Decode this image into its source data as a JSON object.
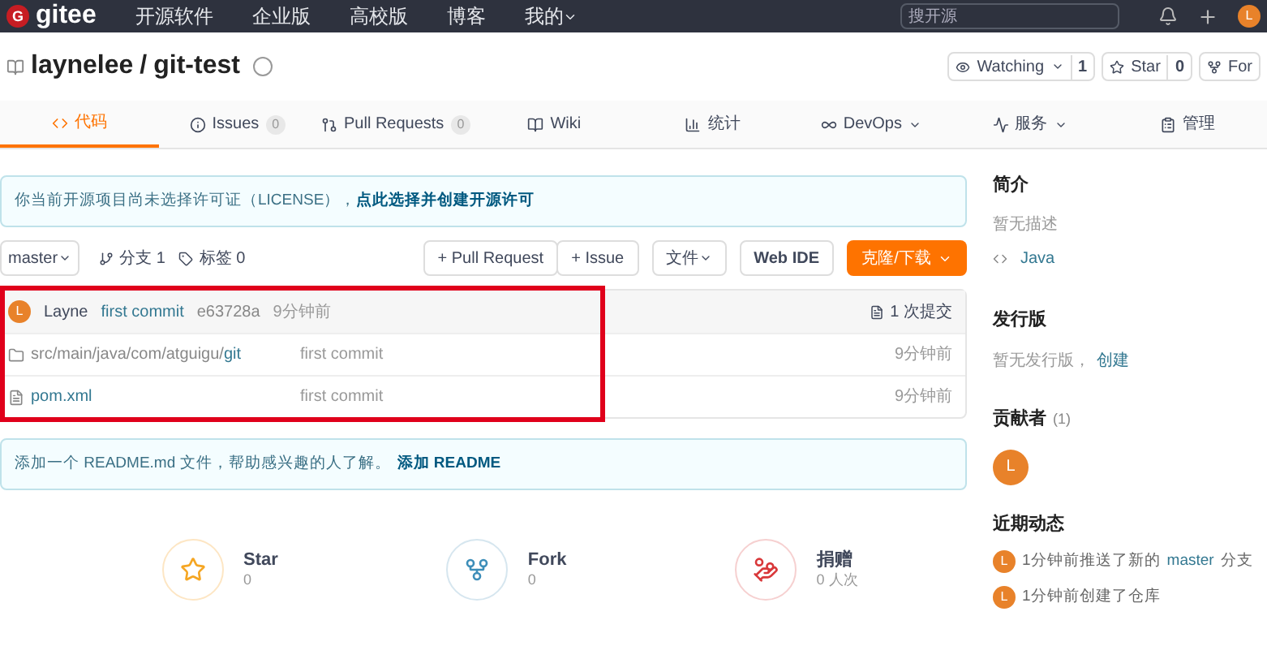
{
  "nav": {
    "logo_mark": "G",
    "logo": "gitee",
    "items": [
      "开源软件",
      "企业版",
      "高校版",
      "博客",
      "我的"
    ],
    "search": {
      "placeholder": "搜开源"
    },
    "avatar": "L"
  },
  "repo": {
    "owner": "laynelee",
    "name": "git-test",
    "separator": "/",
    "actions": [
      {
        "label": "Watching",
        "count": "1",
        "kind": "watch"
      },
      {
        "label": "Star",
        "count": "0",
        "kind": "star"
      },
      {
        "label": "For",
        "kind": "fork"
      }
    ]
  },
  "tabs": [
    {
      "label": "代码",
      "kind": "code",
      "selected": true
    },
    {
      "label": "Issues",
      "count": "0",
      "kind": "issues",
      "selected": false
    },
    {
      "label": "Pull Requests",
      "count": "0",
      "kind": "pr",
      "selected": false
    },
    {
      "label": "Wiki",
      "kind": "wiki",
      "selected": false
    },
    {
      "label": "统计",
      "kind": "stats",
      "selected": false
    },
    {
      "label": "DevOps",
      "kind": "devops",
      "selected": false
    },
    {
      "label": "服务",
      "kind": "service",
      "selected": false
    },
    {
      "label": "管理",
      "kind": "manage",
      "selected": false
    }
  ],
  "license_notice": {
    "text": "你当前开源项目尚未选择许可证（LICENSE），",
    "link": "点此选择并创建开源许可"
  },
  "toolbar": {
    "branch": "master",
    "branches": "分支 1",
    "tags": "标签 0",
    "buttons": [
      "+ Pull Request",
      "+ Issue",
      "文件",
      "Web IDE"
    ],
    "clone": "克隆/下载"
  },
  "commit": {
    "avatar": "L",
    "author": "Layne",
    "message": "first commit",
    "hash": "e63728a",
    "time": "9分钟前",
    "count": "1 次提交"
  },
  "files": [
    {
      "kind": "folder",
      "path": "src/main/java/com/atguigu/",
      "last": "git",
      "message": "first commit",
      "time": "9分钟前"
    },
    {
      "kind": "file",
      "last": "pom.xml",
      "message": "first commit",
      "time": "9分钟前"
    }
  ],
  "highlight": true,
  "readme_notice": {
    "text": "添加一个 README.md 文件，帮助感兴趣的人了解。",
    "link": "添加 README"
  },
  "stats": [
    {
      "kind": "star",
      "label": "Star",
      "value": "0"
    },
    {
      "kind": "fork",
      "label": "Fork",
      "value": "0"
    },
    {
      "kind": "donate",
      "label": "捐赠",
      "value": "0 人次"
    }
  ],
  "sidebar": {
    "intro_title": "简介",
    "intro": "暂无描述",
    "language": "Java",
    "release_title": "发行版",
    "release_text": "暂无发行版，",
    "release_link": "创建",
    "contrib_title": "贡献者",
    "contrib_count": "(1)",
    "contributors": [
      "L"
    ],
    "activity_title": "近期动态",
    "activities": [
      {
        "avatar": "L",
        "text": "1分钟前推送了新的",
        "link": "master",
        "suffix": "分支"
      },
      {
        "avatar": "L",
        "text": "1分钟前创建了仓库"
      }
    ]
  }
}
